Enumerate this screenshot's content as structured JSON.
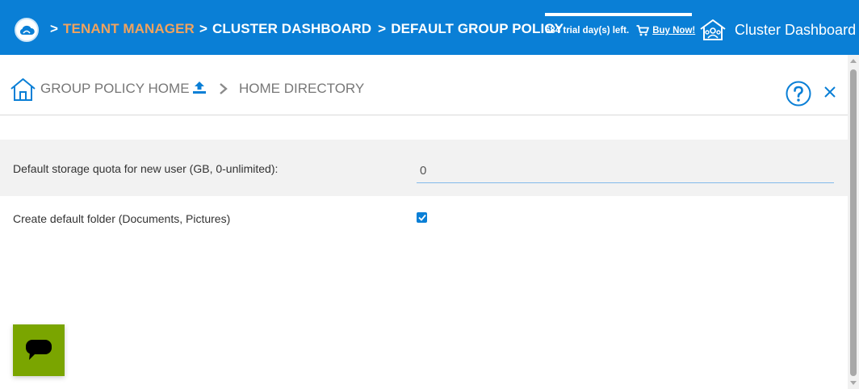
{
  "header": {
    "crumbs": {
      "tenant": "TENANT MANAGER",
      "cluster": "CLUSTER DASHBOARD",
      "policy": "DEFAULT GROUP POLICY",
      "separator": ">"
    },
    "trial_text": "684 trial day(s) left.",
    "buy_now": "Buy Now!",
    "dashboard_label": "Cluster Dashboard",
    "colors": {
      "bar": "#0a7fd6",
      "tenant_accent": "#f0a35e"
    }
  },
  "panel": {
    "home_label": "GROUP POLICY HOME",
    "section_label": "HOME DIRECTORY",
    "icons": [
      "home-icon",
      "upload-icon",
      "chevron-right-icon",
      "help-icon",
      "close-icon"
    ]
  },
  "settings": {
    "quota_label": "Default storage quota for new user (GB, 0-unlimited):",
    "quota_value": "0",
    "folder_label": "Create default folder (Documents, Pictures)",
    "folder_checked": true
  },
  "chat": {
    "icon": "chat-bubble-icon",
    "color": "#7aa500"
  }
}
